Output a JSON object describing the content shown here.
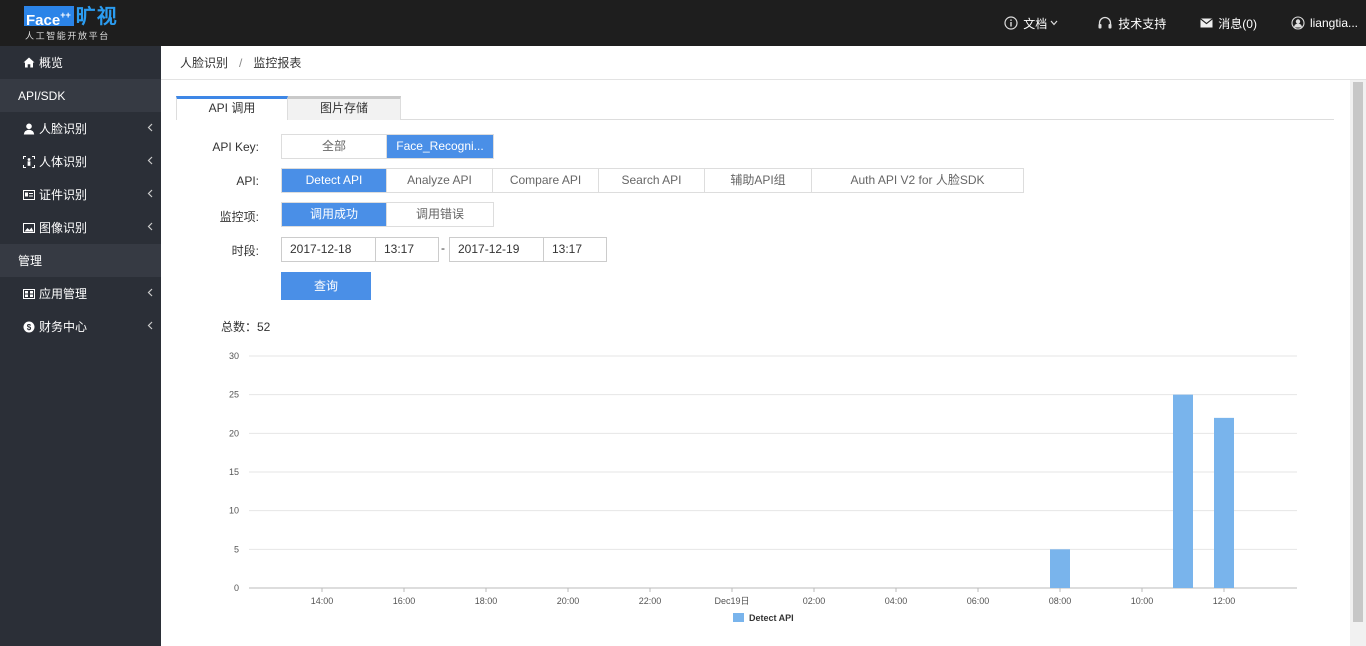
{
  "header": {
    "logo_face": "Face",
    "logo_plus": "++",
    "logo_cn": "旷视",
    "logo_sub": "人工智能开放平台",
    "nav": {
      "docs": "文档",
      "support": "技术支持",
      "messages": "消息(0)",
      "user": "liangtia..."
    }
  },
  "sidebar": {
    "home": "概览",
    "group_api": "API/SDK",
    "items_api": [
      "人脸识别",
      "人体识别",
      "证件识别",
      "图像识别"
    ],
    "group_manage": "管理",
    "items_manage": [
      "应用管理",
      "财务中心"
    ]
  },
  "breadcrumb": {
    "parent": "人脸识别",
    "current": "监控报表"
  },
  "tabs": {
    "active": "API 调用",
    "inactive": "图片存储"
  },
  "form": {
    "apikey_label": "API Key:",
    "apikey_options": [
      "全部",
      "Face_Recogni..."
    ],
    "api_label": "API:",
    "api_options": [
      "Detect API",
      "Analyze API",
      "Compare API",
      "Search API",
      "辅助API组",
      "Auth API V2 for 人脸SDK"
    ],
    "monitor_label": "监控项:",
    "monitor_options": [
      "调用成功",
      "调用错误"
    ],
    "period_label": "时段:",
    "start_date": "2017-12-18",
    "start_time": "13:17",
    "dash": "-",
    "end_date": "2017-12-19",
    "end_time": "13:17",
    "query_button": "查询"
  },
  "total": "总数：52",
  "colors": {
    "accent": "#4a8fe7",
    "bar": "#79b4ec",
    "topbar": "#1e1e1e",
    "sidebar": "#2b2f37"
  },
  "chart_data": {
    "type": "bar",
    "x_ticks": [
      "14:00",
      "16:00",
      "18:00",
      "20:00",
      "22:00",
      "Dec19日",
      "02:00",
      "04:00",
      "06:00",
      "08:00",
      "10:00",
      "12:00"
    ],
    "y_ticks": [
      0,
      5,
      10,
      15,
      20,
      25,
      30
    ],
    "ylim": [
      0,
      30
    ],
    "series": [
      {
        "name": "Detect API",
        "points": [
          {
            "x": "08:00",
            "y": 5
          },
          {
            "x": "11:00",
            "y": 25
          },
          {
            "x": "12:00",
            "y": 22
          }
        ]
      }
    ],
    "legend": "bottom-center",
    "grid": true
  }
}
